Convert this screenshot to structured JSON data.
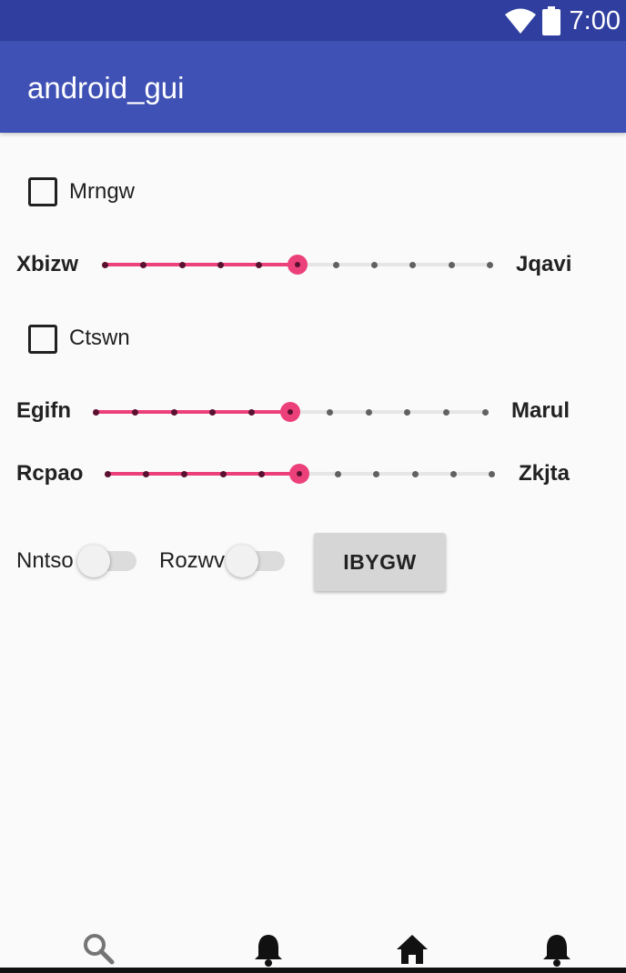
{
  "status_bar": {
    "time": "7:00",
    "icons": [
      "wifi-icon",
      "battery-icon"
    ]
  },
  "app_bar": {
    "title": "android_gui"
  },
  "checkboxes": [
    {
      "label": "Mrngw",
      "checked": false
    },
    {
      "label": "Ctswn",
      "checked": false
    }
  ],
  "sliders": [
    {
      "left_label": "Xbizw",
      "right_label": "Jqavi",
      "value": 5,
      "max": 10
    },
    {
      "left_label": "Egifn",
      "right_label": "Marul",
      "value": 5,
      "max": 10
    },
    {
      "left_label": "Rcpao",
      "right_label": "Zkjta",
      "value": 5,
      "max": 10
    }
  ],
  "switches": [
    {
      "label": "Nntso",
      "on": false
    },
    {
      "label": "Rozwv",
      "on": false
    }
  ],
  "button": {
    "label": "IBYGW"
  },
  "bottom_nav": {
    "items": [
      "search-icon",
      "bell-icon",
      "home-icon",
      "bell-icon"
    ]
  },
  "colors": {
    "status_bar": "#303f9f",
    "app_bar": "#3f51b5",
    "accent": "#ec407a",
    "background": "#fafafa"
  }
}
